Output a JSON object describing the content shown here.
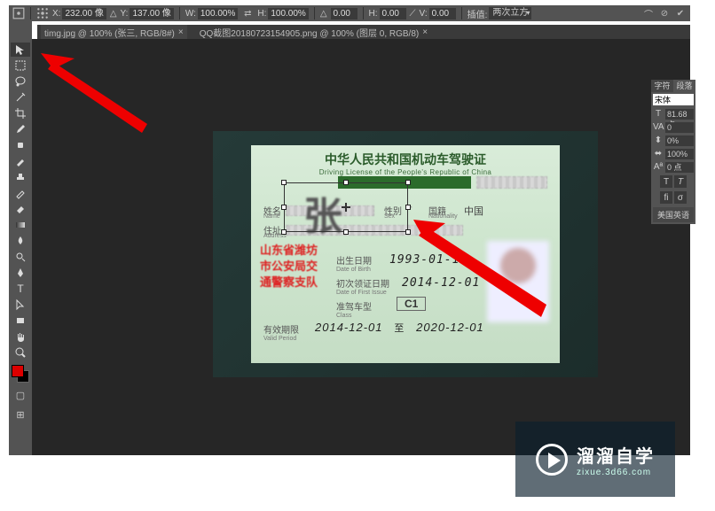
{
  "options": {
    "x_label": "X:",
    "x_value": "232.00 像",
    "y_label": "Y:",
    "y_value": "137.00 像",
    "w_label": "W:",
    "w_value": "100.00%",
    "h_label": "H:",
    "h_value": "100.00%",
    "angle_label": "",
    "angle_value": "0.00",
    "hskew_label": "H:",
    "hskew_value": "0.00",
    "vskew_label": "V:",
    "vskew_value": "0.00",
    "interp_label": "插值:",
    "interp_value": "两次立方"
  },
  "tabs": {
    "a": "timg.jpg @ 100% (张三, RGB/8#)",
    "b": "QQ截图20180723154905.png @ 100% (图层 0, RGB/8)"
  },
  "license": {
    "title_cn": "中华人民共和国机动车驾驶证",
    "title_en": "Driving License of the People's Republic of China",
    "name_label": "姓名",
    "name_en": "Name",
    "big_char": "张",
    "sex_label": "性别",
    "sex_en": "Sex",
    "nation_label": "国籍",
    "nation_en": "Nationality",
    "nation_val": "中国",
    "addr_label": "住址",
    "addr_en": "Address",
    "dob_label": "出生日期",
    "dob_en": "Date of Birth",
    "dob_val": "1993-01-11",
    "issue_label": "初次领证日期",
    "issue_en": "Date of First Issue",
    "issue_val": "2014-12-01",
    "class_label": "准驾车型",
    "class_en": "Class",
    "class_val": "C1",
    "valid_label": "有效期限",
    "valid_en": "Valid Period",
    "valid_from": "2014-12-01",
    "valid_sep": "至",
    "valid_to": "2020-12-01",
    "stamp_l1": "山东省潍坊",
    "stamp_l2": "市公安局交",
    "stamp_l3": "通警察支队"
  },
  "char_panel": {
    "tab1": "字符",
    "tab2": "段落",
    "font": "宋体",
    "size": "81.68 点",
    "tracking": "0",
    "vscale": "0%",
    "hscale": "100%",
    "baseline": "0 点",
    "bold": "T",
    "italic": "T",
    "lang": "美国英语"
  },
  "watermark": {
    "line1": "溜溜自学",
    "line2": "zixue.3d66.com"
  }
}
